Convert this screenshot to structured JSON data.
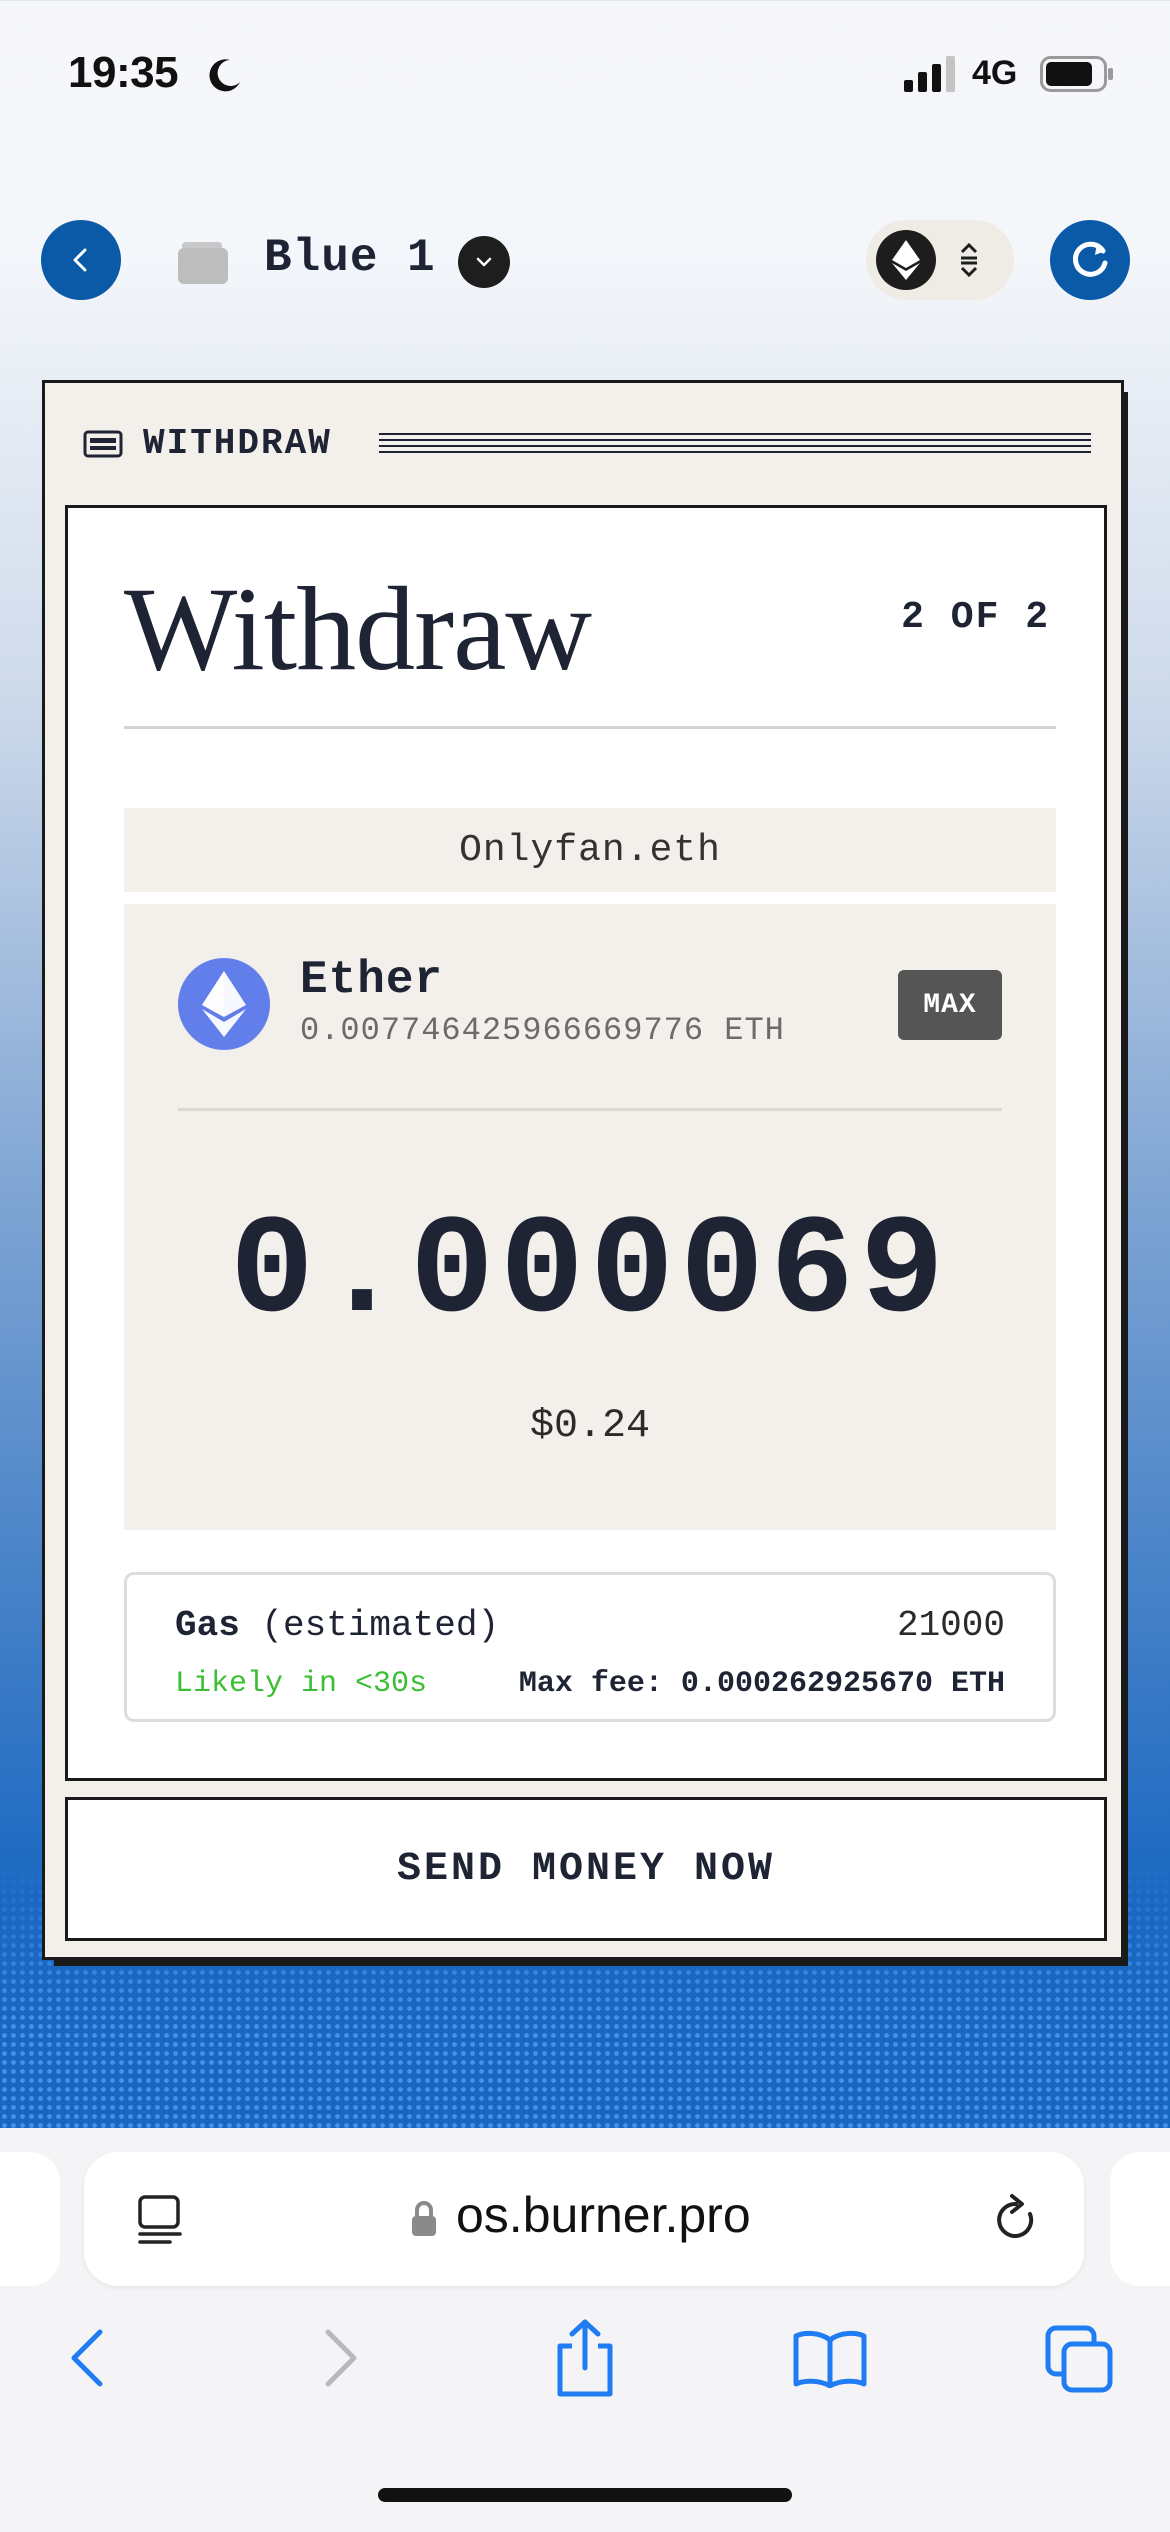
{
  "status_bar": {
    "time": "19:35",
    "network": "4G"
  },
  "app_bar": {
    "wallet_name": "Blue 1"
  },
  "window": {
    "title": "WITHDRAW"
  },
  "form": {
    "heading": "Withdraw",
    "step": "2 OF 2",
    "recipient": "Onlyfan.eth",
    "asset": {
      "name": "Ether",
      "balance": "0.007746425966669776 ETH",
      "max_label": "MAX",
      "icon": "ethereum-icon"
    },
    "amount": "0.000069",
    "amount_usd": "$0.24",
    "gas": {
      "label_bold": "Gas",
      "label_rest": " (estimated)",
      "limit": "21000",
      "speed": "Likely in <30s",
      "max_fee": "Max fee: 0.000262925670 ETH"
    },
    "submit_label": "SEND MONEY NOW"
  },
  "browser": {
    "address": "os.burner.pro"
  },
  "colors": {
    "accent_blue": "#0b5aa8",
    "ink": "#1e2433",
    "panel": "#f3f0eb",
    "success_green": "#3bbf34",
    "eth_purple": "#627eea"
  }
}
